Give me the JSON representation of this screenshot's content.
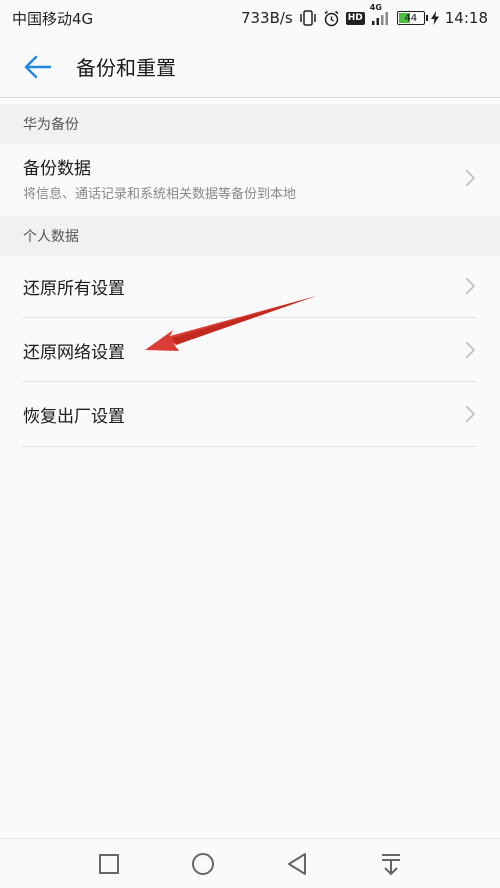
{
  "status_bar": {
    "carrier": "中国移动4G",
    "speed": "733B/s",
    "hd": "HD",
    "network": "4G",
    "battery_level": "44",
    "battery_fraction": 0.44,
    "time": "14:18"
  },
  "header": {
    "title": "备份和重置"
  },
  "sections": [
    {
      "label": "华为备份",
      "items": [
        {
          "title": "备份数据",
          "subtitle": "将信息、通话记录和系统相关数据等备份到本地"
        }
      ]
    },
    {
      "label": "个人数据",
      "items": [
        {
          "title": "还原所有设置"
        },
        {
          "title": "还原网络设置"
        },
        {
          "title": "恢复出厂设置"
        }
      ]
    }
  ],
  "colors": {
    "accent": "#1e88e5",
    "annotation_arrow": "#d9342b"
  },
  "icons": {
    "back": "arrow-left-icon",
    "chevron": "chevron-right-icon",
    "nav": [
      "square-icon",
      "circle-icon",
      "triangle-back-icon",
      "notification-pull-icon"
    ]
  }
}
